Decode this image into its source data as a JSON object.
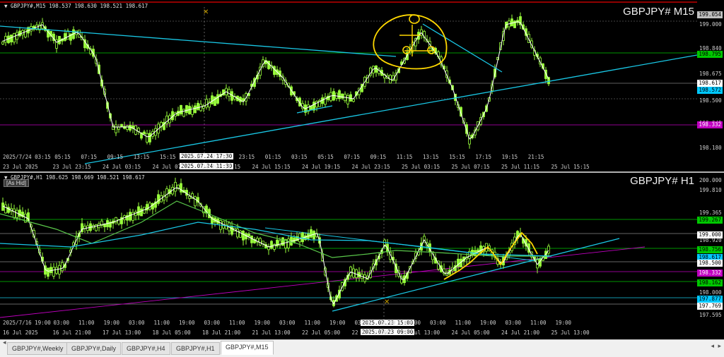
{
  "top_chart": {
    "header": "▼ GBPJPY#,M15  198.537 198.630 198.521 198.617",
    "symbol": "GBPJPY#  M15",
    "axis_ticks": [
      "199.000",
      "198.840",
      "198.675",
      "198.500",
      "198.345",
      "198.180"
    ],
    "price_labels": [
      {
        "text": "199.054",
        "bg": "#bfbfbf",
        "fg": "#000000"
      },
      {
        "text": "198.795",
        "bg": "#00c800",
        "fg": "#000000"
      },
      {
        "text": "198.617",
        "bg": "#ffffff",
        "fg": "#000000"
      },
      {
        "text": "198.572",
        "bg": "#00c8ff",
        "fg": "#000000"
      },
      {
        "text": "198.332",
        "bg": "#c000c0",
        "fg": "#ffffff"
      }
    ],
    "time_labels": [
      "23 Jul 2025",
      "23 Jul 23:15",
      "24 Jul 03:15",
      "24 Jul 07:15",
      "24 Jul 11:15",
      "24 Jul 15:15",
      "24 Jul 19:15",
      "24 Jul 23:15",
      "25 Jul 03:15",
      "25 Jul 07:15",
      "25 Jul 11:15",
      "25 Jul 15:15"
    ],
    "time_labels_upper": [
      "2025/7/24 03:15",
      "05:15",
      "07:15",
      "09:15",
      "13:15",
      "15:15",
      "19:15",
      "21:15",
      "23:15",
      "01:15",
      "03:15",
      "05:15",
      "07:15",
      "09:15",
      "11:15",
      "13:15",
      "15:15",
      "17:15",
      "19:15",
      "21:15"
    ],
    "crosshair_time_a": "2025.07.24 17:30",
    "crosshair_time_b": "2025.07.24 11:30"
  },
  "bottom_chart": {
    "header": "▼ GBPJPY#,H1  198.625 198.669 198.521 198.617",
    "symbol": "GBPJPY#  H1",
    "as_hidden": "[As Hid]",
    "axis_ticks": [
      "200.000",
      "199.810",
      "199.365",
      "198.920",
      "198.500",
      "198.000",
      "197.595"
    ],
    "price_labels": [
      {
        "text": "199.267",
        "bg": "#00c800",
        "fg": "#000000"
      },
      {
        "text": "199.000",
        "bg": "#ffffff",
        "fg": "#000000"
      },
      {
        "text": "198.756",
        "bg": "#00c800",
        "fg": "#000000"
      },
      {
        "text": "198.617",
        "bg": "#00c8ff",
        "fg": "#000000"
      },
      {
        "text": "198.500",
        "bg": "#ffffff",
        "fg": "#000000"
      },
      {
        "text": "198.332",
        "bg": "#c000c0",
        "fg": "#ffffff"
      },
      {
        "text": "198.162",
        "bg": "#00c800",
        "fg": "#000000"
      },
      {
        "text": "197.877",
        "bg": "#00c8ff",
        "fg": "#000000"
      },
      {
        "text": "197.769",
        "bg": "#ffffff",
        "fg": "#000000"
      }
    ],
    "time_labels": [
      "16 Jul 2025",
      "16 Jul 21:00",
      "17 Jul 13:00",
      "18 Jul 05:00",
      "18 Jul 21:00",
      "21 Jul 13:00",
      "22 Jul 05:00",
      "22 Jul 21:00",
      "23 Jul 13:00",
      "24 Jul 05:00",
      "24 Jul 21:00",
      "25 Jul 13:00"
    ],
    "time_labels_upper": [
      "2025/7/16 19:00",
      "03:00",
      "11:00",
      "19:00",
      "03:00",
      "11:00",
      "19:00",
      "03:00",
      "11:00",
      "19:00",
      "03:00",
      "11:00",
      "19:00",
      "03:00",
      "11:00",
      "19:00",
      "03:00",
      "11:00",
      "19:00",
      "03:00",
      "11:00",
      "19:00"
    ],
    "crosshair_time_a": "2025.07.23 15:00",
    "crosshair_time_b": "2025.07.23 09:00"
  },
  "tabs": [
    {
      "label": "GBPJPY#,Weekly",
      "active": false
    },
    {
      "label": "GBPJPY#,Daily",
      "active": false
    },
    {
      "label": "GBPJPY#,H4",
      "active": false
    },
    {
      "label": "GBPJPY#,H1",
      "active": false
    },
    {
      "label": "GBPJPY#,M15",
      "active": true
    }
  ],
  "colors": {
    "candle": "#9aff3c",
    "trendline": "#19c8e6",
    "annotation": "#ffd800",
    "magenta": "#c000c0",
    "green_level": "#00c800"
  }
}
